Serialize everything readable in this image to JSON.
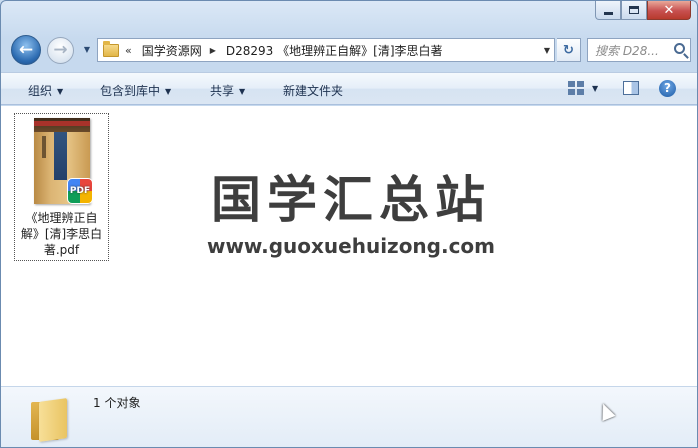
{
  "window": {
    "close_glyph": "✕"
  },
  "nav": {
    "back_glyph": "←",
    "forward_glyph": "→",
    "history_glyph": "▼"
  },
  "address": {
    "chevron": "«",
    "crumbs": [
      "国学资源网",
      "D28293 《地理辨正自解》[清]李思白著"
    ],
    "separator": "▶",
    "dropdown_glyph": "▼"
  },
  "refresh_glyph": "↻",
  "search": {
    "placeholder": "搜索 D28..."
  },
  "toolbar": {
    "organize": "组织",
    "include_library": "包含到库中",
    "share": "共享",
    "new_folder": "新建文件夹",
    "dropdown_glyph": "▼",
    "help_glyph": "?"
  },
  "file": {
    "name": "《地理辨正自解》[清]李思白著.pdf",
    "badge": "PDF"
  },
  "watermark": {
    "title": "国学汇总站",
    "url": "www.guoxuehuizong.com"
  },
  "status": {
    "count": "1 个对象"
  },
  "colors": {
    "accent": "#2d6cb2",
    "close_button": "#c75050",
    "window_frame": "#c6d9ee"
  }
}
